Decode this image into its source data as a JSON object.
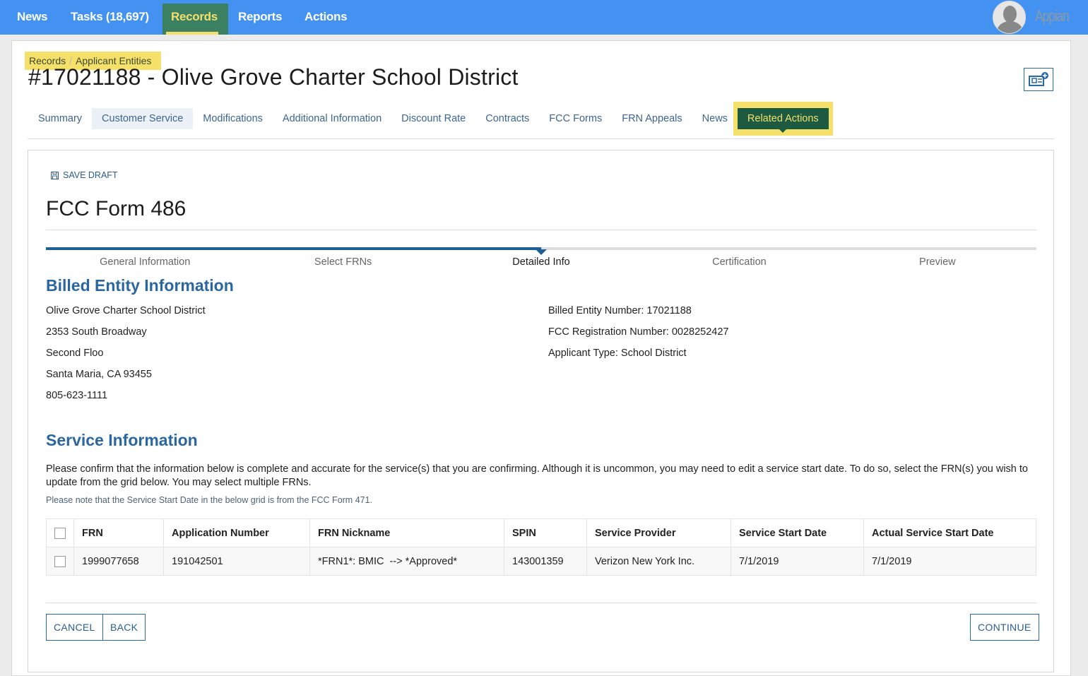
{
  "topnav": {
    "items": [
      "News",
      "Tasks (18,697)",
      "Records",
      "Reports",
      "Actions"
    ],
    "active": "Records",
    "logo": "Appian"
  },
  "breadcrumb": [
    "Records",
    "Applicant Entities"
  ],
  "record_title": "#17021188 - Olive Grove Charter School District",
  "tabs": [
    "Summary",
    "Customer Service",
    "Modifications",
    "Additional Information",
    "Discount Rate",
    "Contracts",
    "FCC Forms",
    "FRN Appeals",
    "News"
  ],
  "related_actions": "Related Actions",
  "form": {
    "save_draft": "SAVE DRAFT",
    "title": "FCC Form 486",
    "progress_percent": 50,
    "steps": [
      "General Information",
      "Select FRNs",
      "Detailed Info",
      "Certification",
      "Preview"
    ],
    "current_step": "Detailed Info",
    "billed_heading": "Billed Entity Information",
    "address": [
      "Olive Grove Charter School District",
      "2353 South Broadway",
      "Second Floo",
      "Santa Maria, CA 93455",
      "805-623-1111"
    ],
    "entity_info": [
      "Billed Entity Number: 17021188",
      "FCC Registration Number: 0028252427",
      "Applicant Type: School District"
    ],
    "service_heading": "Service Information",
    "instructions": "Please confirm that the information below is complete and accurate for the service(s) that you are confirming. Although it is uncommon, you may need to edit a service start date. To do so, select the FRN(s) you wish to update from the grid below. You may select multiple FRNs.",
    "note": "Please note that the Service Start Date in the below grid is from the FCC Form 471.",
    "table": {
      "columns": [
        "FRN",
        "Application Number",
        "FRN Nickname",
        "SPIN",
        "Service Provider",
        "Service Start Date",
        "Actual Service Start Date"
      ],
      "rows": [
        [
          "1999077658",
          "191042501",
          "*FRN1*: BMIC  --> *Approved*",
          "143001359",
          "Verizon New York Inc.",
          "7/1/2019",
          "7/1/2019"
        ]
      ]
    },
    "buttons": {
      "cancel": "CANCEL",
      "back": "BACK",
      "continue": "CONTINUE"
    }
  },
  "colors": {
    "topbar": "#4391f0",
    "accent": "#2a67a0",
    "highlight": "#f5e06a",
    "active_nav": "#3c8062"
  }
}
